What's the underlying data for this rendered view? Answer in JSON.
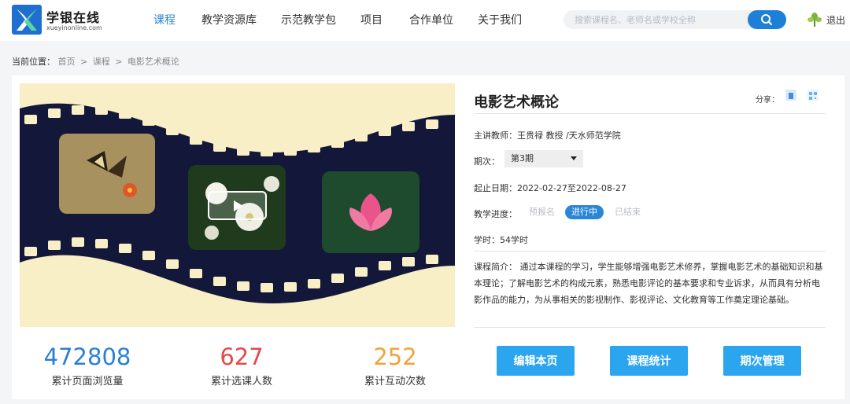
{
  "header": {
    "logo_title": "学银在线",
    "logo_url": "xueyinonline.com",
    "nav": [
      {
        "label": "课程",
        "active": true
      },
      {
        "label": "教学资源库",
        "active": false
      },
      {
        "label": "示范教学包",
        "active": false
      },
      {
        "label": "项目",
        "active": false
      },
      {
        "label": "合作单位",
        "active": false
      },
      {
        "label": "关于我们",
        "active": false
      }
    ],
    "search_placeholder": "搜索课程名、老师名或学校全称",
    "logout_label": "退出"
  },
  "breadcrumb": {
    "label": "当前位置：",
    "items": [
      "首页",
      "课程",
      "电影艺术概论"
    ],
    "separator": ">"
  },
  "video": {
    "play_icon": "play-icon"
  },
  "stats": [
    {
      "value": "472808",
      "label": "累计页面浏览量",
      "color": "#2a7fd4"
    },
    {
      "value": "627",
      "label": "累计选课人数",
      "color": "#e5484d"
    },
    {
      "value": "252",
      "label": "累计互动次数",
      "color": "#f1a33b"
    }
  ],
  "course": {
    "title": "电影艺术概论",
    "share_label": "分享：",
    "teacher": "主讲教师：王贵禄 教授 /天水师范学院",
    "period_label": "期次：",
    "period_value": "第3期",
    "dates": "起止日期：2022-02-27至2022-08-27",
    "progress_label": "教学进度：",
    "progress_states": [
      "预报名",
      "进行中",
      "已结束"
    ],
    "progress_active_index": 1,
    "hours": "学时：54学时",
    "description": "课程简介： 通过本课程的学习，学生能够增强电影艺术修养，掌握电影艺术的基础知识和基本理论；了解电影艺术的构成元素，熟悉电影评论的基本要求和专业诉求，从而具有分析电影作品的能力，为从事相关的影视制作、影视评论、文化教育等工作奠定理论基础。"
  },
  "actions": [
    "编辑本页",
    "课程统计",
    "期次管理"
  ],
  "colors": {
    "brand_blue": "#2a86d6",
    "action_button": "#2ba6ee"
  }
}
